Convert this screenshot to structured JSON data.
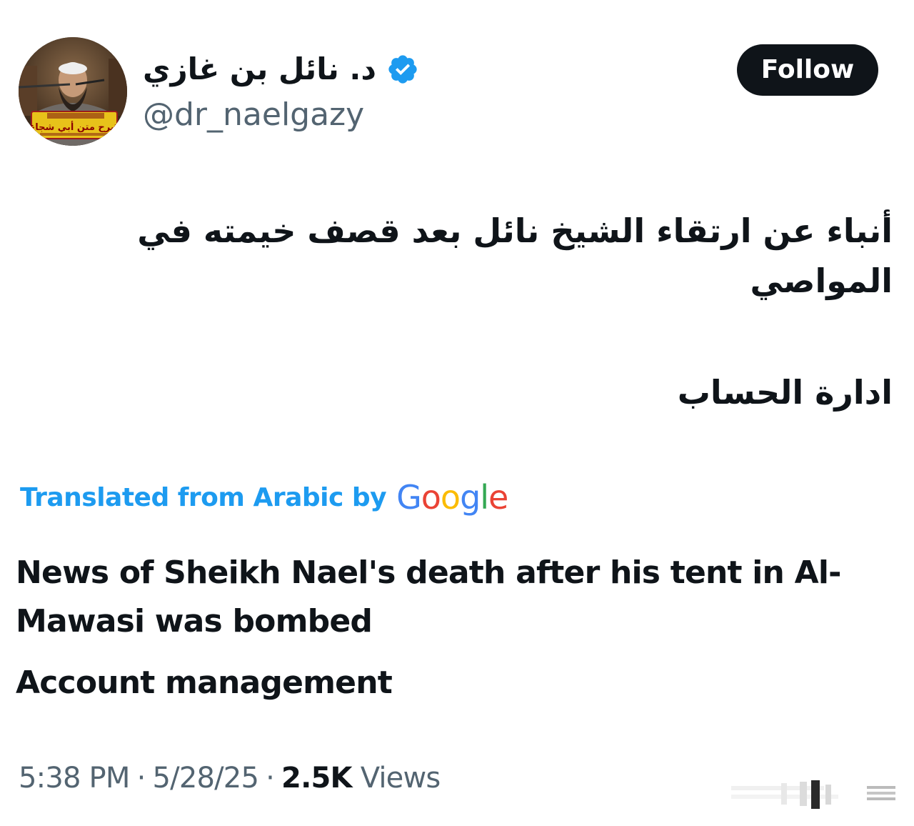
{
  "author": {
    "display_name": "د. نائل بن غازي",
    "handle": "@dr_naelgazy",
    "verified": true,
    "avatar_banner_text": "شرح متن أبي شجاع"
  },
  "follow_button": {
    "label": "Follow"
  },
  "tweet": {
    "text_arabic_1": "أنباء عن ارتقاء الشيخ نائل بعد قصف خيمته في المواصي",
    "text_arabic_2": "ادارة الحساب"
  },
  "translation": {
    "label": "Translated from Arabic by",
    "provider": "Google",
    "text_1": "News of Sheikh Nael's death after his tent in Al-Mawasi was bombed",
    "text_2": "Account management"
  },
  "meta": {
    "time": "5:38 PM",
    "separator": "·",
    "date": "5/28/25",
    "views_count": "2.5K",
    "views_label": "Views"
  },
  "colors": {
    "text_primary": "#0f1419",
    "text_secondary": "#536471",
    "accent_blue": "#1d9bf0",
    "follow_bg": "#0f1419",
    "google_blue": "#4285f4",
    "google_red": "#ea4335",
    "google_yellow": "#fbbc05",
    "google_green": "#34a853"
  },
  "icons": {
    "verified": "verified-badge-icon",
    "watermark": "watermark-icon"
  }
}
